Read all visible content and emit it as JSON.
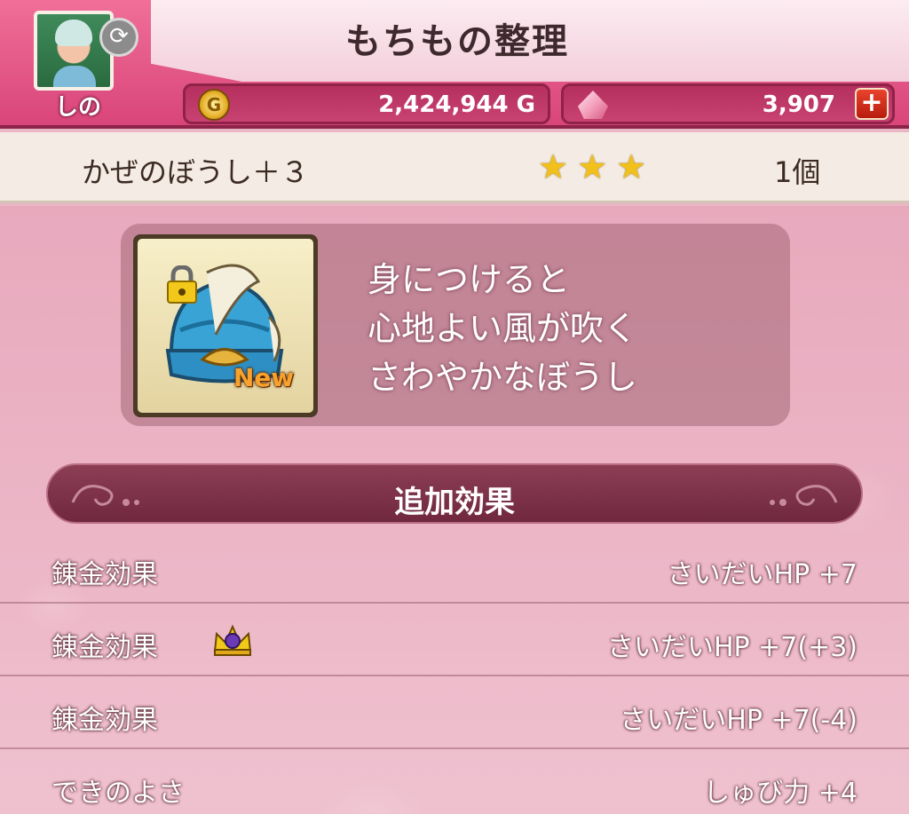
{
  "header": {
    "title": "もちもの整理",
    "player_name": "しの",
    "gold_value": "2,424,944 G",
    "gold_icon_letter": "G",
    "gem_value": "3,907",
    "plus_label": "+"
  },
  "item": {
    "name": "かぜのぼうし＋３",
    "stars": 3,
    "count": "1個",
    "new_badge": "New",
    "description": [
      "身につけると",
      "心地よい風が吹く",
      "さわやかなぼうし"
    ]
  },
  "effects": {
    "section_title": "追加効果",
    "rows": [
      {
        "label": "錬金効果",
        "value": "さいだいHP  +7",
        "crown": false
      },
      {
        "label": "錬金効果",
        "value": "さいだいHP  +7(+3)",
        "crown": true
      },
      {
        "label": "錬金効果",
        "value": "さいだいHP  +7(-4)",
        "crown": false
      },
      {
        "label": "できのよさ",
        "value": "しゅび力  +4",
        "crown": false
      }
    ]
  },
  "colors": {
    "header_pink": "#e8598a",
    "star_gold": "#f2c01b",
    "section_bg": "#7d3249"
  }
}
